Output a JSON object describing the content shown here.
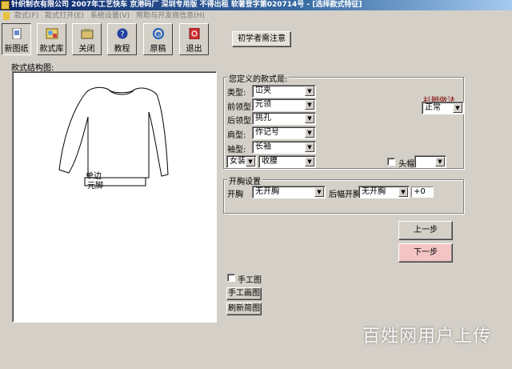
{
  "title_bar": {
    "text": "针织制衣有限公司   2007年工艺快车 京港码厂 深圳专用版    不得出租   软著登字第020714号 - [选择款式特征]"
  },
  "menu": {
    "items": [
      "款式(F)",
      "款式打开(E)",
      "系统设置(V)",
      "帮助与开发商信息(H)"
    ]
  },
  "toolbar": {
    "buttons": [
      {
        "label": "新图纸",
        "icon": "new-drawing-icon"
      },
      {
        "label": "款式库",
        "icon": "style-library-icon"
      },
      {
        "label": "关闭",
        "icon": "close-icon"
      },
      {
        "label": "教程",
        "icon": "help-icon"
      },
      {
        "label": "原稿",
        "icon": "ie-icon"
      },
      {
        "label": "退出",
        "icon": "exit-icon"
      }
    ],
    "beginner_button": "初学者需注意"
  },
  "structure": {
    "label": "款式结构图:",
    "hem_label": "单边",
    "hem_value": "元脚"
  },
  "style_group": {
    "title": "您定义的款式是:",
    "fields": [
      {
        "label": "类型:",
        "value": "冚夹"
      },
      {
        "label": "前领型",
        "value": "元领"
      },
      {
        "label": "后领型",
        "value": "挑孔"
      },
      {
        "label": "肩型:",
        "value": "作记号"
      },
      {
        "label": "袖型:",
        "value": "长袖"
      }
    ],
    "gender": "女装",
    "waist": "收腰",
    "hem_method_label": "衫脚做法",
    "hem_method_value": "正常",
    "hood_label": "头帽",
    "hood_value": ""
  },
  "opening_group": {
    "title": "开胸设置",
    "front_label": "开胸",
    "front_value": "无开胸",
    "back_label": "后幅开胸",
    "back_value": "无开胸",
    "offset": "+0"
  },
  "nav": {
    "prev": "上一步",
    "next": "下一步"
  },
  "manual": {
    "checkbox_label": "手工图",
    "draw_button": "手工画图",
    "refresh_button": "刷新简图"
  },
  "watermark": "百姓网用户上传",
  "colors": {
    "window_bg": "#d4d0c8",
    "next_button_bg": "#f4c4c4",
    "hem_method_label": "#800000"
  }
}
